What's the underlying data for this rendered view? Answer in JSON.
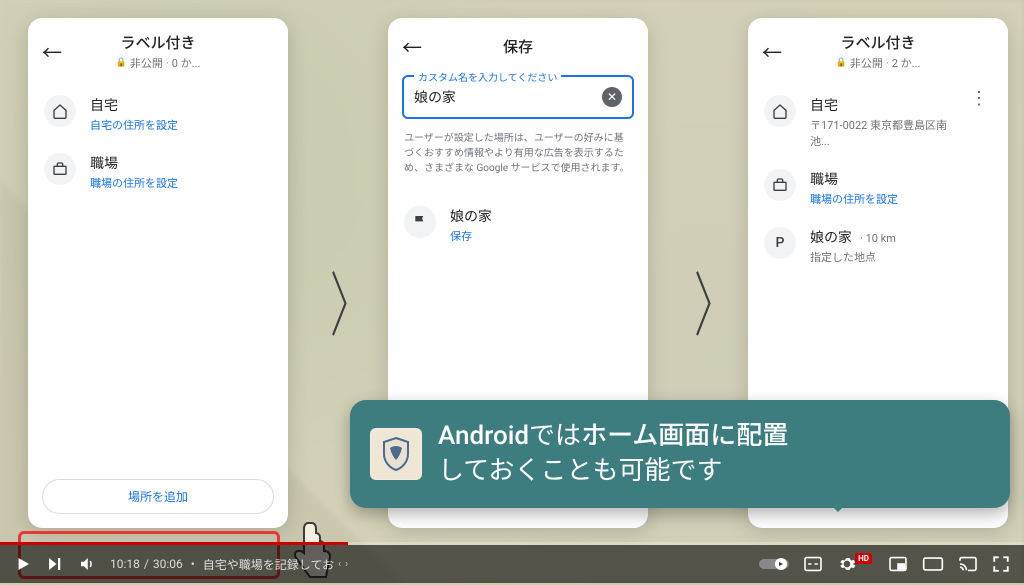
{
  "phone1": {
    "title": "ラベル付き",
    "privacy": "非公開",
    "count": "0 か...",
    "items": [
      {
        "icon": "home",
        "label": "自宅",
        "sub": "自宅の住所を設定"
      },
      {
        "icon": "work",
        "label": "職場",
        "sub": "職場の住所を設定"
      }
    ],
    "add_button": "場所を追加"
  },
  "phone2": {
    "title": "保存",
    "input_label": "カスタム名を入力してください",
    "input_value": "娘の家",
    "hint": "ユーザーが設定した場所は、ユーザーの好みに基づくおすすめ情報やより有用な広告を表示するため、さまざまな Google サービスで使用されます。",
    "result": {
      "label": "娘の家",
      "action": "保存"
    }
  },
  "phone3": {
    "title": "ラベル付き",
    "privacy": "非公開",
    "count": "2 か...",
    "items": [
      {
        "icon": "home",
        "label": "自宅",
        "sub": "〒171-0022 東京都豊島区南池..."
      },
      {
        "icon": "work",
        "label": "職場",
        "sub": "職場の住所を設定",
        "sub_blue": true
      },
      {
        "icon": "P",
        "label": "娘の家",
        "meta": "10 km",
        "sub": "指定した地点"
      }
    ]
  },
  "caption": {
    "text1_prefix": "",
    "keyword1": "Android",
    "text1_mid": "では",
    "keyword2": "ホーム画面に配置",
    "text2": "しておくことも可能です"
  },
  "player": {
    "current": "10:18",
    "total": "30:06",
    "chapter": "自宅や職場を記録してお"
  }
}
